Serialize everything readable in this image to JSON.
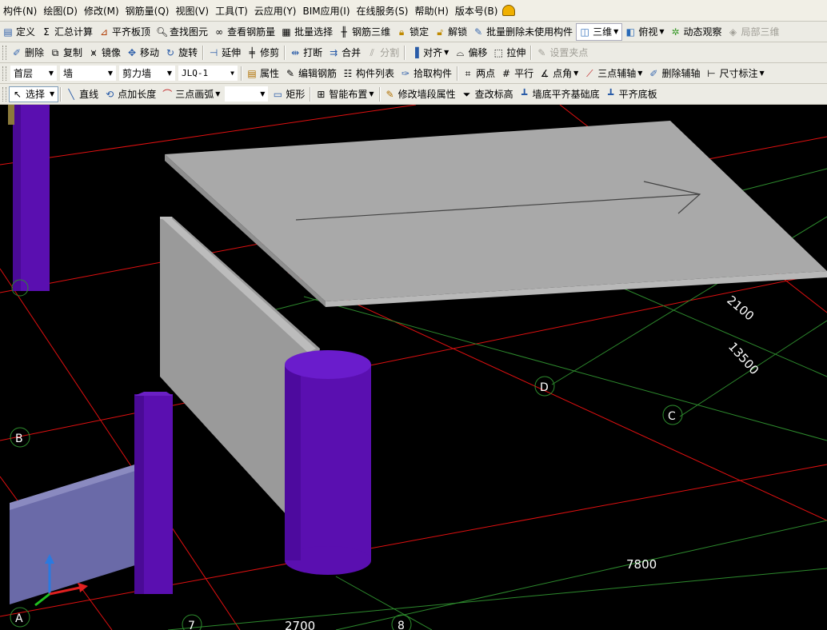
{
  "menus": [
    "构件(N)",
    "绘图(D)",
    "修改(M)",
    "钢筋量(Q)",
    "视图(V)",
    "工具(T)",
    "云应用(Y)",
    "BIM应用(I)",
    "在线服务(S)",
    "帮助(H)",
    "版本号(B)"
  ],
  "toolbar1": {
    "define": "定义",
    "sum_calc": "汇总计算",
    "flat_top": "平齐板顶",
    "find_elem": "查找图元",
    "view_rebar": "查看钢筋量",
    "batch_select": "批量选择",
    "rebar_3d": "钢筋三维",
    "lock": "锁定",
    "unlock": "解锁",
    "batch_delete": "批量删除未使用构件",
    "view_3d": "三维",
    "top_view": "俯视",
    "dynamic_view": "动态观察",
    "local_3d": "局部三维"
  },
  "toolbar2": {
    "delete": "删除",
    "copy": "复制",
    "mirror": "镜像",
    "move": "移动",
    "rotate": "旋转",
    "extend": "延伸",
    "trim": "修剪",
    "break": "打断",
    "merge": "合并",
    "split": "分割",
    "align": "对齐",
    "offset": "偏移",
    "stretch": "拉伸",
    "set_grip": "设置夹点"
  },
  "toolbar3": {
    "floor": "首层",
    "category": "墙",
    "type": "剪力墙",
    "element": "JLQ-1",
    "properties": "属性",
    "edit_rebar": "编辑钢筋",
    "component_list": "构件列表",
    "pick_component": "拾取构件",
    "two_points": "两点",
    "parallel": "平行",
    "point_angle": "点角",
    "three_point_aux": "三点辅轴",
    "delete_aux": "删除辅轴",
    "dimension": "尺寸标注"
  },
  "toolbar4": {
    "select": "选择",
    "line": "直线",
    "point_length": "点加长度",
    "arc": "三点画弧",
    "arc_value": "",
    "rectangle": "矩形",
    "smart_layout": "智能布置",
    "modify_segment": "修改墙段属性",
    "check_elevation": "查改标高",
    "wall_bottom_flush": "墙底平齐基础底",
    "flush_slab_bottom": "平齐底板"
  },
  "viewport": {
    "axis_labels": [
      "D",
      "C",
      "B",
      "A",
      "7",
      "8"
    ],
    "dimensions": [
      "2100",
      "13500",
      "7800",
      "2700"
    ],
    "colors": {
      "background": "#000000",
      "column": "#5a0fb0",
      "slab": "#a9a9a9",
      "wall": "#9a9a9a",
      "grid_red": "#e01010",
      "grid_green": "#2d8a2d",
      "beam": "#6a6aa8"
    }
  }
}
